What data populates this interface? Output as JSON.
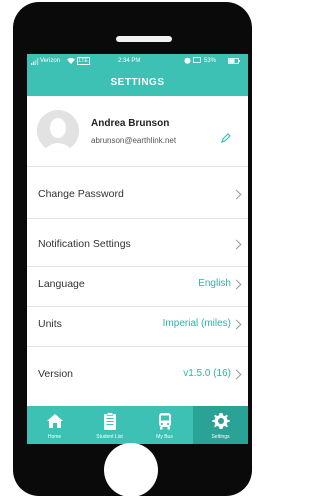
{
  "status_bar": {
    "carrier": "Verizon",
    "network": "LTE",
    "time": "2:34 PM",
    "battery": "53%"
  },
  "header": {
    "title": "SETTINGS"
  },
  "profile": {
    "name": "Andrea Brunson",
    "email": "abrunson@earthlink.net"
  },
  "settings": [
    {
      "label": "Change Password",
      "value": ""
    },
    {
      "label": "Notification Settings",
      "value": ""
    },
    {
      "label": "Language",
      "value": "English"
    },
    {
      "label": "Units",
      "value": "Imperial (miles)"
    },
    {
      "label": "Version",
      "value": "v1.5.0 (16)"
    }
  ],
  "tabs": [
    {
      "label": "Home",
      "icon": "home-icon"
    },
    {
      "label": "Student List",
      "icon": "clipboard-icon"
    },
    {
      "label": "My Bus",
      "icon": "bus-icon"
    },
    {
      "label": "Settings",
      "icon": "gear-icon"
    }
  ],
  "colors": {
    "accent": "#3dc1b4",
    "accent_dark": "#2aa396",
    "value_text": "#2fb3a6"
  }
}
